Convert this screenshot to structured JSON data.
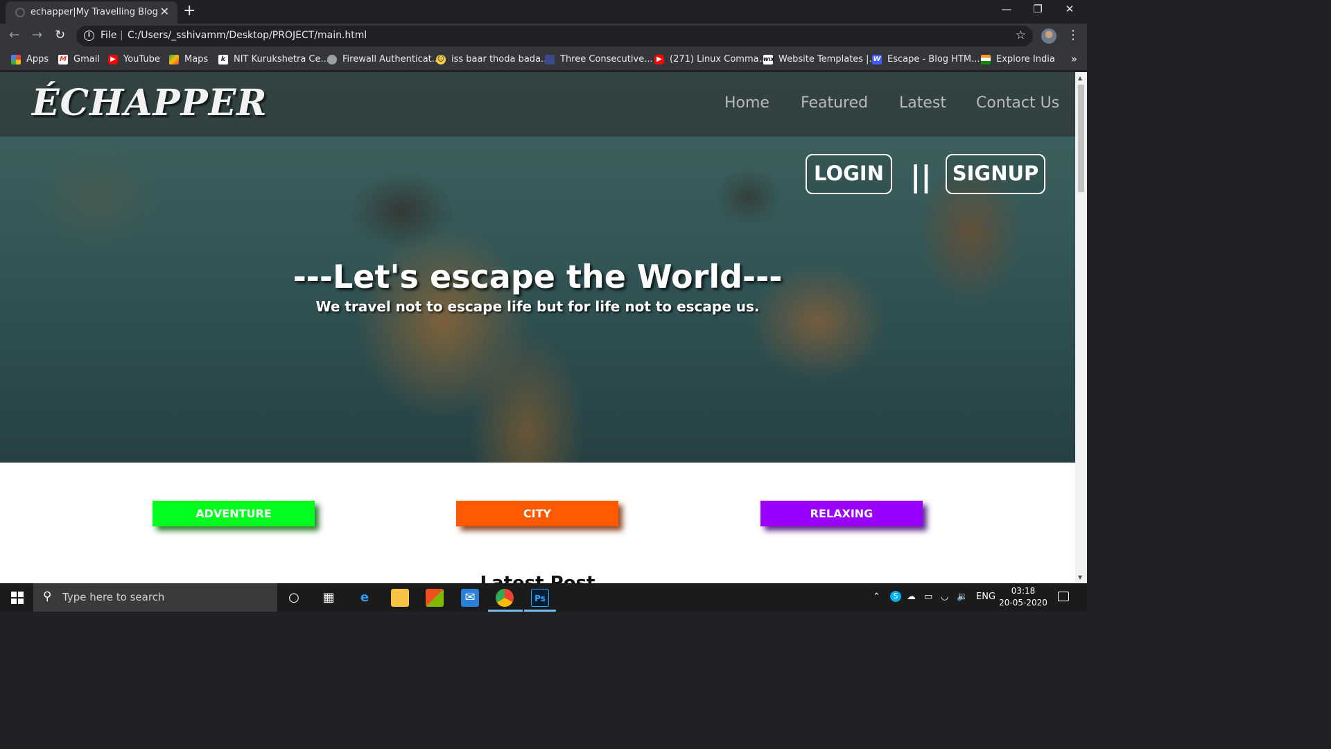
{
  "browser": {
    "tab_title": "echapper|My Travelling Blog",
    "tab_close": "✕",
    "new_tab": "+",
    "url_scheme_label": "File",
    "url": "C:/Users/_sshivamm/Desktop/PROJECT/main.html"
  },
  "bookmarks": [
    {
      "label": "Apps",
      "icon": "apps-grid-icon",
      "color": "#ea4335"
    },
    {
      "label": "Gmail",
      "icon": "gmail-icon",
      "color": "#ea4335"
    },
    {
      "label": "YouTube",
      "icon": "youtube-icon",
      "color": "#ff0000"
    },
    {
      "label": "Maps",
      "icon": "maps-icon",
      "color": "#34a853"
    },
    {
      "label": "NIT Kurukshetra Ce...",
      "icon": "nit-icon",
      "color": "#ffffff"
    },
    {
      "label": "Firewall Authenticat...",
      "icon": "globe-icon",
      "color": "#9aa0a6"
    },
    {
      "label": "iss baar thoda bada...",
      "icon": "emoji-icon",
      "color": "#f7d046"
    },
    {
      "label": "Three Consecutive...",
      "icon": "bookmark-icon",
      "color": "#3b4a8a"
    },
    {
      "label": "(271) Linux Comma...",
      "icon": "youtube-icon",
      "color": "#ff0000"
    },
    {
      "label": "Website Templates |...",
      "icon": "wix-icon",
      "color": "#ffffff"
    },
    {
      "label": "Escape - Blog HTM...",
      "icon": "w-icon",
      "color": "#3d5afe"
    },
    {
      "label": "Explore India",
      "icon": "india-flag-icon",
      "color": "#ff9933"
    }
  ],
  "site": {
    "logo": "ÉCHAPPER",
    "nav": [
      "Home",
      "Featured",
      "Latest",
      "Contact Us"
    ],
    "login": "LOGIN",
    "separator": "||",
    "signup": "SIGNUP",
    "hero_title": "---Let's escape the World---",
    "hero_subtitle": "We travel not to escape life but for life not to escape us.",
    "categories": [
      {
        "label": "ADVENTURE",
        "color": "#00ff1e",
        "shadow": "#2e7d32"
      },
      {
        "label": "CITY",
        "color": "#ff5a00",
        "shadow": "#8d4a2a"
      },
      {
        "label": "RELAXING",
        "color": "#9900ff",
        "shadow": "#5a2a8a"
      }
    ],
    "latest_heading": "Latest Post"
  },
  "taskbar": {
    "search_placeholder": "Type here to search",
    "language": "ENG",
    "time": "03:18",
    "date": "20-05-2020"
  }
}
